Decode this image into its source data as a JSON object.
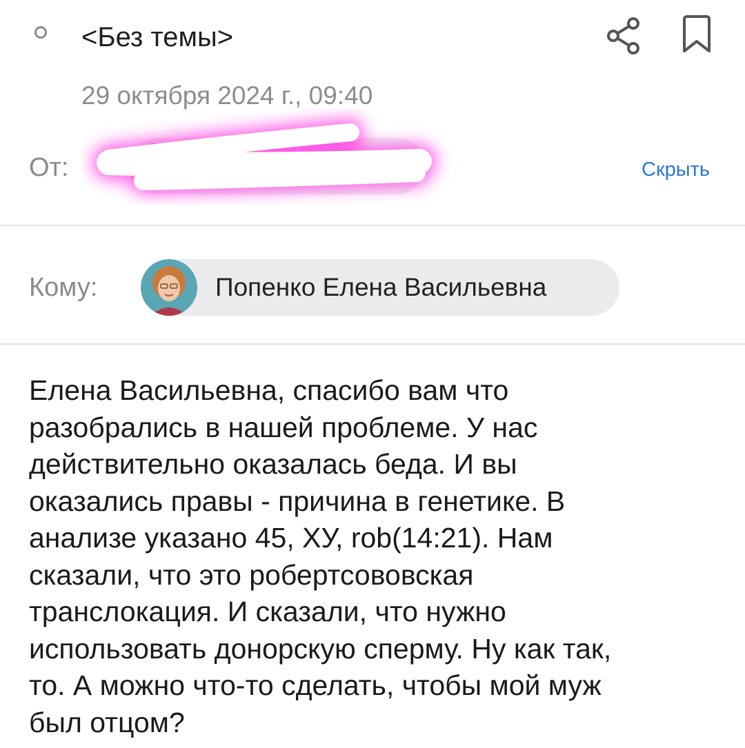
{
  "header": {
    "subject": "<Без темы>",
    "date": "29 октября 2024 г., 09:40",
    "icons": {
      "status": "unread-status-icon",
      "share": "share-icon",
      "bookmark": "bookmark-icon"
    }
  },
  "from": {
    "label": "От:",
    "hide_link": "Скрыть"
  },
  "to": {
    "label": "Кому:",
    "recipient_name": "Попенко Елена Васильевна"
  },
  "body": {
    "lines": [
      "Елена Васильевна, спасибо вам что",
      "разобрались в нашей проблеме. У нас",
      "действительно оказалась беда. И вы",
      "оказались правы - причина в генетике. В",
      "анализе указано 45, ХУ, rob(14:21). Нам",
      "сказали, что это робертсововская",
      "транслокация. И сказали, что нужно",
      "использовать донорскую сперму. Ну как так,",
      "то. А можно что-то  сделать, чтобы мой муж",
      "был отцом?"
    ]
  },
  "colors": {
    "link": "#2677d8",
    "muted": "#8a8a8a",
    "chip_bg": "#ebebee",
    "redaction_glow": "#ff4de6"
  }
}
